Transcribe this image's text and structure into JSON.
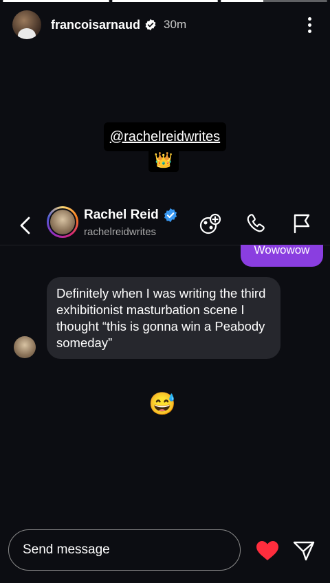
{
  "story": {
    "progress": [
      1.0,
      1.0,
      0.4
    ],
    "username": "francoisarnaud",
    "time": "30m",
    "mention": "@rachelreidwrites",
    "crown_emoji": "👑"
  },
  "dm": {
    "name": "Rachel Reid",
    "handle": "rachelreidwrites",
    "sent_message": "Wowowow",
    "received_message": "Definitely when I was writing the third exhibitionist masturbation scene I thought “this is gonna win a Peabody someday”",
    "reaction_emoji": "😅"
  },
  "footer": {
    "input_placeholder": "Send message"
  },
  "colors": {
    "background": "#0c0d12",
    "sent_bubble": "#8a3ee0",
    "received_bubble": "#26272d",
    "verified_blue": "#3897f0",
    "heart_red": "#ff2d3d"
  },
  "icons": [
    "verified-icon",
    "more-icon",
    "back-icon",
    "add-collab-icon",
    "phone-icon",
    "flag-icon",
    "heart-icon",
    "send-icon"
  ]
}
